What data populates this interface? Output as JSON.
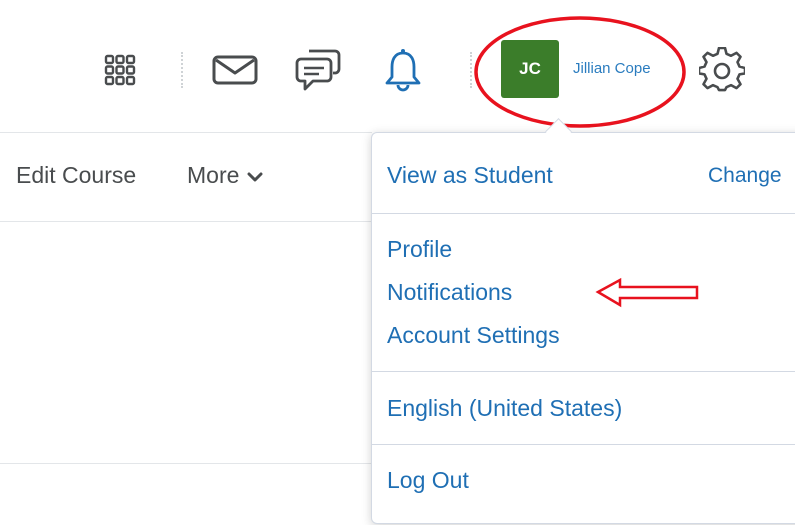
{
  "navbar": {
    "icons": [
      "apps-grid-icon",
      "mail-icon",
      "chat-icon",
      "bell-icon",
      "gear-icon"
    ],
    "user": {
      "initials": "JC",
      "name": "Jillian Cope",
      "avatar_color": "#3b7d2a"
    }
  },
  "course_bar": {
    "edit_course": "Edit Course",
    "more": "More"
  },
  "dropdown": {
    "view_as": "View as Student",
    "change": "Change",
    "items": [
      "Profile",
      "Notifications",
      "Account Settings"
    ],
    "language": "English (United States)",
    "logout": "Log Out"
  },
  "colors": {
    "link": "#1f6fb4",
    "annotation_red": "#e8121e"
  }
}
